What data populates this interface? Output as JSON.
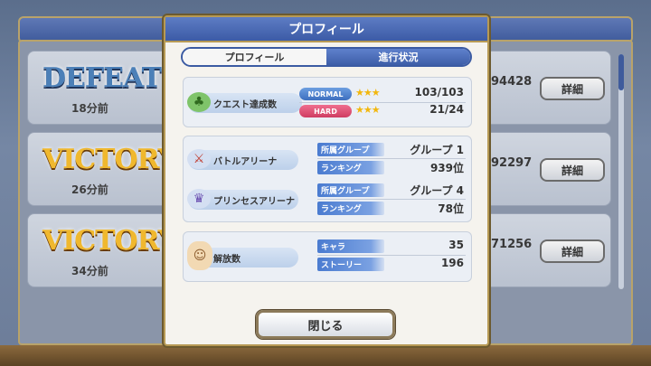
{
  "background": {
    "rows": [
      {
        "result": "DEFEAT",
        "type": "defeat",
        "time": "18分前",
        "id": "94428",
        "detail_label": "詳細"
      },
      {
        "result": "VICTORY",
        "type": "victory",
        "time": "26分前",
        "id": "92297",
        "detail_label": "詳細"
      },
      {
        "result": "VICTORY",
        "type": "victory",
        "time": "34分前",
        "id": "71256",
        "detail_label": "詳細"
      }
    ]
  },
  "modal": {
    "title": "プロフィール",
    "tabs": [
      {
        "label": "プロフィール",
        "active": false
      },
      {
        "label": "進行状況",
        "active": true
      }
    ],
    "quest": {
      "label": "クエスト達成数",
      "normal": {
        "pill": "NORMAL",
        "stars": "★★★",
        "value": "103/103"
      },
      "hard": {
        "pill": "HARD",
        "stars": "★★★",
        "value": "21/24"
      }
    },
    "arena": [
      {
        "label": "バトルアリーナ",
        "group_key": "所属グループ",
        "group_value": "グループ 1",
        "rank_key": "ランキング",
        "rank_value": "939位"
      },
      {
        "label": "プリンセスアリーナ",
        "group_key": "所属グループ",
        "group_value": "グループ 4",
        "rank_key": "ランキング",
        "rank_value": "78位"
      }
    ],
    "unlocks": {
      "label": "解放数",
      "chara_key": "キャラ",
      "chara_value": "35",
      "story_key": "ストーリー",
      "story_value": "196"
    },
    "close_label": "閉じる"
  },
  "colors": {
    "accent_blue": "#3d5ea8",
    "gold_border": "#b79a55",
    "hard_pink": "#cf3d62",
    "star_gold": "#f2b70e"
  }
}
